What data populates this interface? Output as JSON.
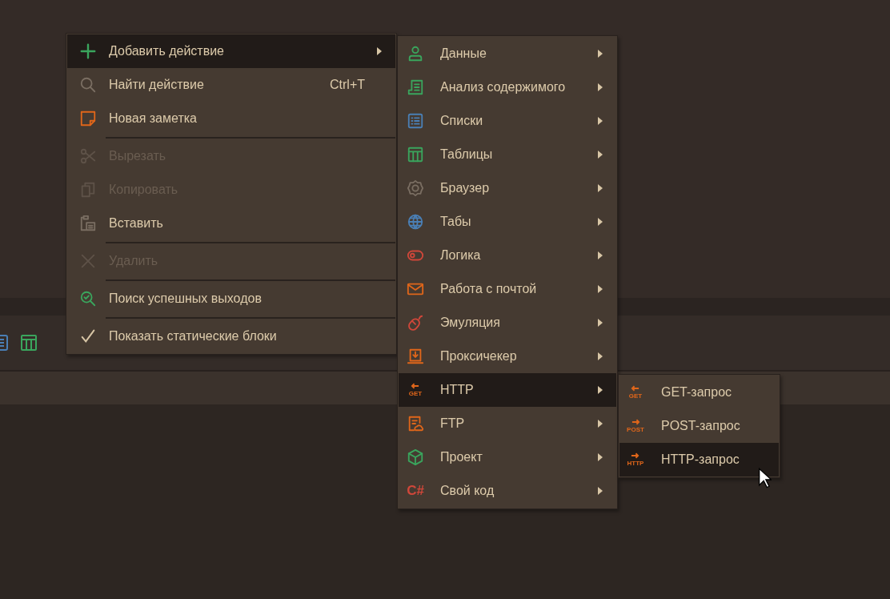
{
  "main_menu": {
    "items": [
      {
        "label": "Добавить действие",
        "selected": true,
        "disabled": false,
        "checked": false,
        "has_submenu": true,
        "separator_after": false
      },
      {
        "label": "Найти действие",
        "shortcut": "Ctrl+T",
        "selected": false,
        "disabled": false,
        "checked": false,
        "has_submenu": false,
        "separator_after": false
      },
      {
        "label": "Новая заметка",
        "selected": false,
        "disabled": false,
        "checked": false,
        "has_submenu": false,
        "separator_after": true
      },
      {
        "label": "Вырезать",
        "selected": false,
        "disabled": true,
        "checked": false,
        "has_submenu": false,
        "separator_after": false
      },
      {
        "label": "Копировать",
        "selected": false,
        "disabled": true,
        "checked": false,
        "has_submenu": false,
        "separator_after": false
      },
      {
        "label": "Вставить",
        "selected": false,
        "disabled": false,
        "checked": false,
        "has_submenu": false,
        "separator_after": true
      },
      {
        "label": "Удалить",
        "selected": false,
        "disabled": true,
        "checked": false,
        "has_submenu": false,
        "separator_after": true
      },
      {
        "label": "Поиск успешных выходов",
        "selected": false,
        "disabled": false,
        "checked": false,
        "has_submenu": false,
        "separator_after": true
      },
      {
        "label": "Показать статические блоки",
        "selected": false,
        "disabled": false,
        "checked": true,
        "has_submenu": false,
        "separator_after": false
      }
    ]
  },
  "submenu": {
    "items": [
      {
        "label": "Данные",
        "selected": false,
        "has_submenu": true
      },
      {
        "label": "Анализ содержимого",
        "selected": false,
        "has_submenu": true
      },
      {
        "label": "Списки",
        "selected": false,
        "has_submenu": true
      },
      {
        "label": "Таблицы",
        "selected": false,
        "has_submenu": true
      },
      {
        "label": "Браузер",
        "selected": false,
        "has_submenu": true
      },
      {
        "label": "Табы",
        "selected": false,
        "has_submenu": true
      },
      {
        "label": "Логика",
        "selected": false,
        "has_submenu": true
      },
      {
        "label": "Работа с почтой",
        "selected": false,
        "has_submenu": true
      },
      {
        "label": "Эмуляция",
        "selected": false,
        "has_submenu": true
      },
      {
        "label": "Проксичекер",
        "selected": false,
        "has_submenu": true
      },
      {
        "label": "HTTP",
        "icon_text": "GET",
        "selected": true,
        "has_submenu": true
      },
      {
        "label": "FTP",
        "selected": false,
        "has_submenu": true
      },
      {
        "label": "Проект",
        "selected": false,
        "has_submenu": true
      },
      {
        "label": "Свой код",
        "icon_text": "C#",
        "selected": false,
        "has_submenu": true
      }
    ]
  },
  "http_submenu": {
    "items": [
      {
        "label": "GET-запрос",
        "icon_text": "GET",
        "kind": "incoming",
        "selected": false
      },
      {
        "label": "POST-запрос",
        "icon_text": "POST",
        "kind": "outgoing",
        "selected": false
      },
      {
        "label": "HTTP-запрос",
        "icon_text": "HTTP",
        "kind": "outgoing",
        "selected": true
      }
    ]
  }
}
